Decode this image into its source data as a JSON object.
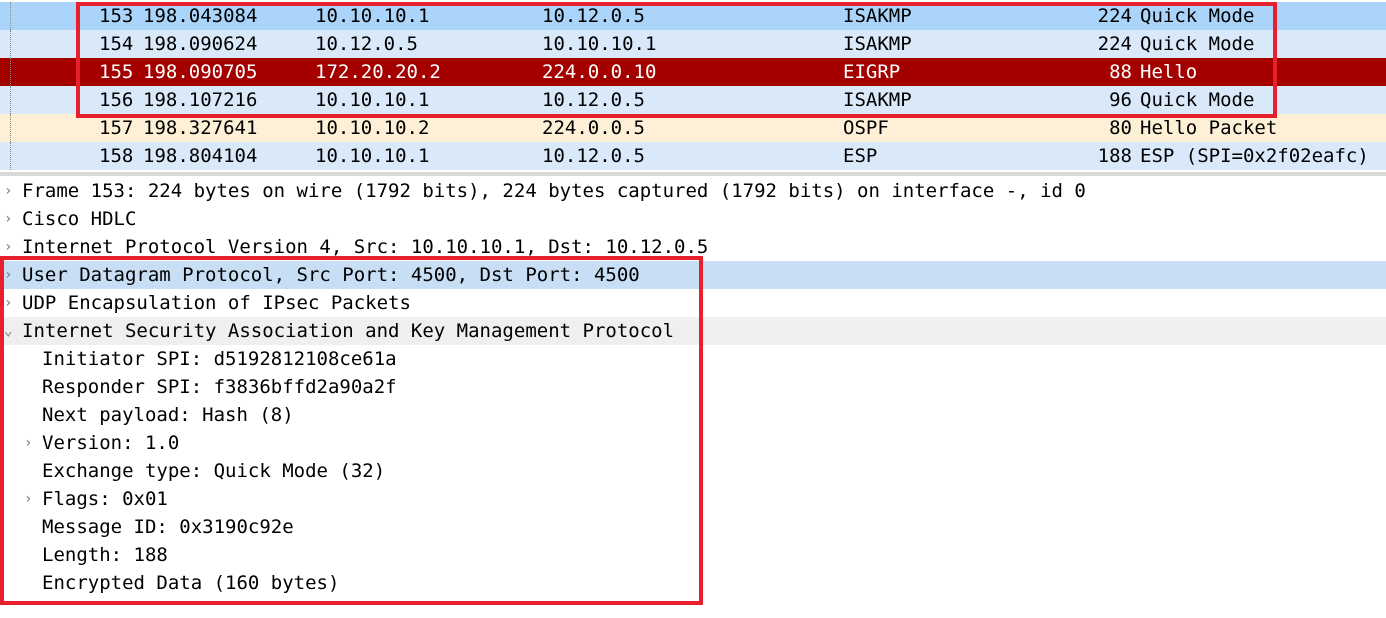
{
  "packets": [
    {
      "no": "153",
      "time": "198.043084",
      "src": "10.10.10.1",
      "dst": "10.12.0.5",
      "proto": "ISAKMP",
      "len": "224",
      "info": "Quick Mode",
      "bg": "#abd4fa",
      "fg": "#000000"
    },
    {
      "no": "154",
      "time": "198.090624",
      "src": "10.12.0.5",
      "dst": "10.10.10.1",
      "proto": "ISAKMP",
      "len": "224",
      "info": "Quick Mode",
      "bg": "#dae9fa",
      "fg": "#000000"
    },
    {
      "no": "155",
      "time": "198.090705",
      "src": "172.20.20.2",
      "dst": "224.0.0.10",
      "proto": "EIGRP",
      "len": "88",
      "info": "Hello",
      "bg": "#a40000",
      "fg": "#ffffff"
    },
    {
      "no": "156",
      "time": "198.107216",
      "src": "10.10.10.1",
      "dst": "10.12.0.5",
      "proto": "ISAKMP",
      "len": "96",
      "info": "Quick Mode",
      "bg": "#dae9fa",
      "fg": "#000000"
    },
    {
      "no": "157",
      "time": "198.327641",
      "src": "10.10.10.2",
      "dst": "224.0.0.5",
      "proto": "OSPF",
      "len": "80",
      "info": "Hello Packet",
      "bg": "#fdf0d6",
      "fg": "#000000"
    },
    {
      "no": "158",
      "time": "198.804104",
      "src": "10.10.10.1",
      "dst": "10.12.0.5",
      "proto": "ESP",
      "len": "188",
      "info": "ESP (SPI=0x2f02eafc)",
      "bg": "#dae9fa",
      "fg": "#000000"
    }
  ],
  "details": [
    {
      "text": "Frame 153: 224 bytes on wire (1792 bits), 224 bytes captured (1792 bits) on interface -, id 0",
      "arrow": "›",
      "level": 0,
      "bg": "#ffffff"
    },
    {
      "text": "Cisco HDLC",
      "arrow": "›",
      "level": 0,
      "bg": "#ffffff"
    },
    {
      "text": "Internet Protocol Version 4, Src: 10.10.10.1, Dst: 10.12.0.5",
      "arrow": "›",
      "level": 0,
      "bg": "#ffffff"
    },
    {
      "text": "User Datagram Protocol, Src Port: 4500, Dst Port: 4500",
      "arrow": "›",
      "level": 0,
      "bg": "#c7def5"
    },
    {
      "text": "UDP Encapsulation of IPsec Packets",
      "arrow": "›",
      "level": 0,
      "bg": "#ffffff"
    },
    {
      "text": "Internet Security Association and Key Management Protocol",
      "arrow": "⌄",
      "level": 0,
      "bg": "#efefef"
    },
    {
      "text": "Initiator SPI: d5192812108ce61a",
      "arrow": "",
      "level": 1,
      "bg": "#ffffff"
    },
    {
      "text": "Responder SPI: f3836bffd2a90a2f",
      "arrow": "",
      "level": 1,
      "bg": "#ffffff"
    },
    {
      "text": "Next payload: Hash (8)",
      "arrow": "",
      "level": 1,
      "bg": "#ffffff"
    },
    {
      "text": "Version: 1.0",
      "arrow": "›",
      "level": 1,
      "bg": "#ffffff"
    },
    {
      "text": "Exchange type: Quick Mode (32)",
      "arrow": "",
      "level": 1,
      "bg": "#ffffff"
    },
    {
      "text": "Flags: 0x01",
      "arrow": "›",
      "level": 1,
      "bg": "#ffffff"
    },
    {
      "text": "Message ID: 0x3190c92e",
      "arrow": "",
      "level": 1,
      "bg": "#ffffff"
    },
    {
      "text": "Length: 188",
      "arrow": "",
      "level": 1,
      "bg": "#ffffff"
    },
    {
      "text": "Encrypted Data (160 bytes)",
      "arrow": "",
      "level": 1,
      "bg": "#ffffff"
    }
  ],
  "highlight_color": "#e8202e"
}
